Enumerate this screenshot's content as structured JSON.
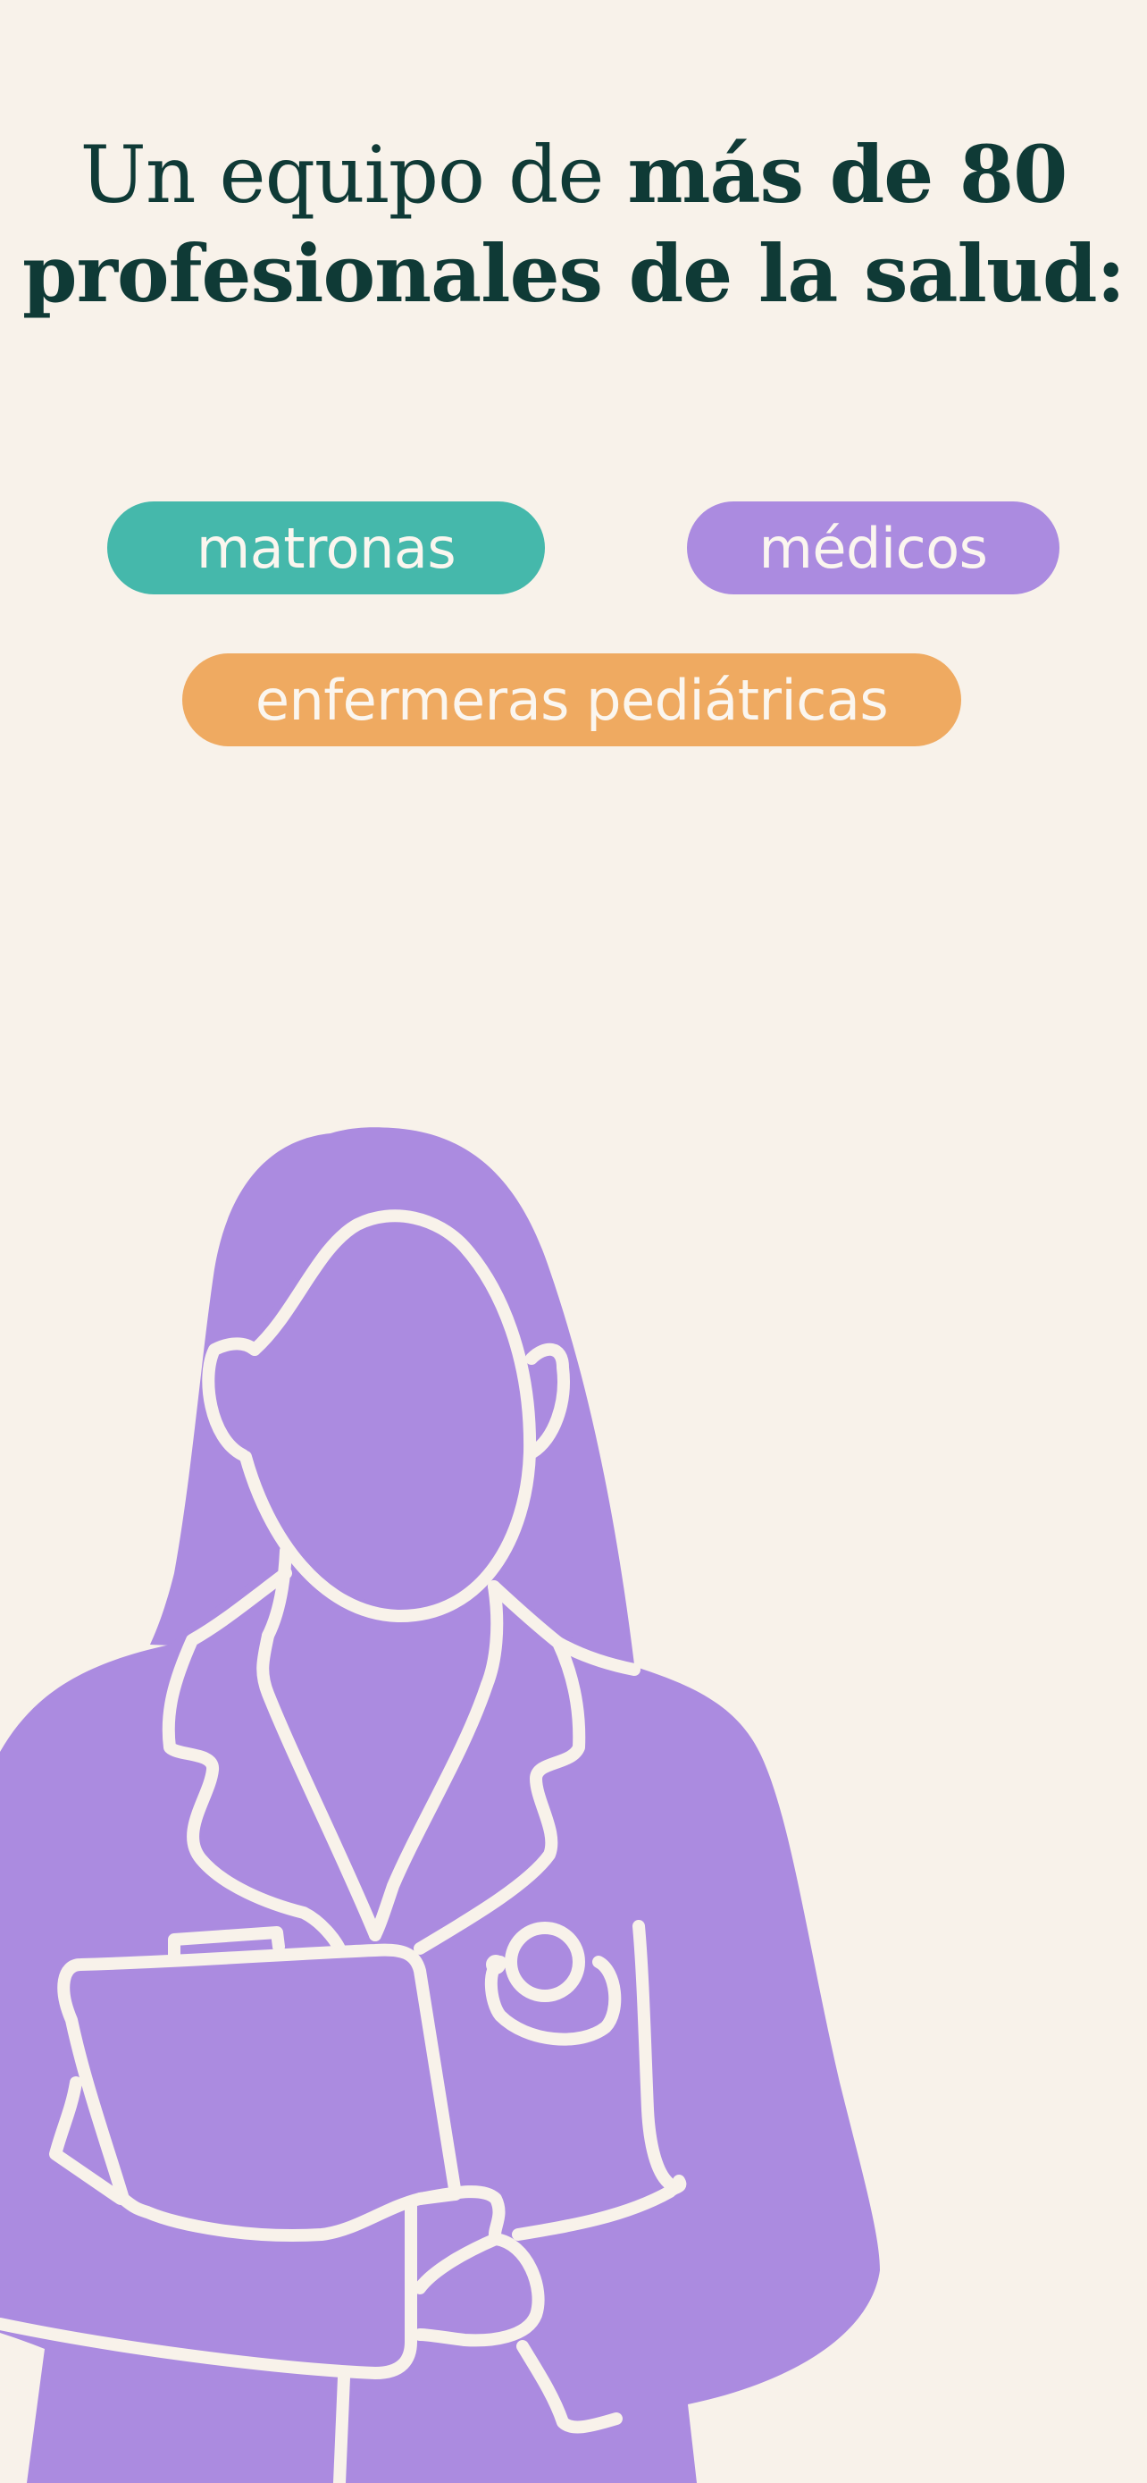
{
  "heading": {
    "line1_light": "Un equipo de ",
    "line1_bold": "más de 80",
    "line2_bold": "profesionales de la salud:"
  },
  "professions": [
    {
      "label": "matronas",
      "color": "#45b8ab"
    },
    {
      "label": "médicos",
      "color": "#ab8be0"
    },
    {
      "label": "enfermeras pediátricas",
      "color": "#efaa61"
    }
  ],
  "illustration": {
    "fill": "#ab8be0",
    "stroke": "#f8f2ea"
  },
  "colors": {
    "background": "#f8f2ea",
    "heading_text": "#0f3a36",
    "pill_text": "#fbf6ef"
  }
}
